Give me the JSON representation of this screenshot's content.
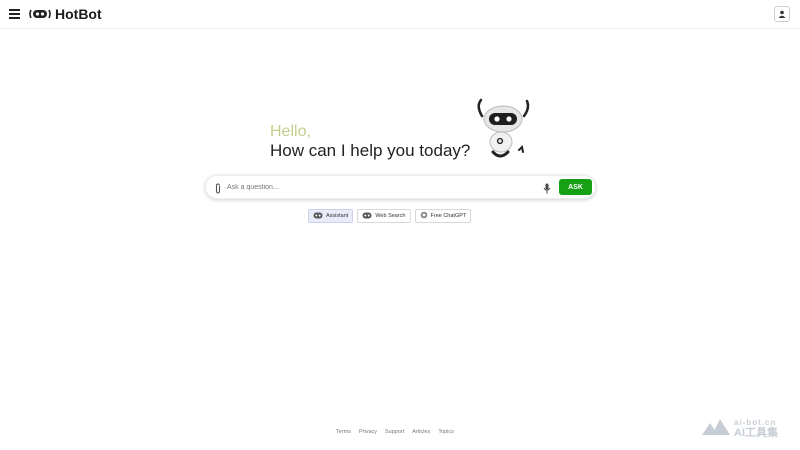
{
  "header": {
    "brand_name": "HotBot",
    "menu_icon": "hamburger-menu-icon",
    "logo_icon": "robot-logo-icon",
    "user_icon": "user-icon"
  },
  "hero": {
    "greeting": "Hello,",
    "headline": "How can I help you today?",
    "greeting_color": "#c2cf8a",
    "mascot_icon": "robot-mascot-icon"
  },
  "search": {
    "placeholder": "Ask a question...",
    "value": "",
    "attach_icon": "paperclip-icon",
    "mic_icon": "microphone-icon",
    "ask_label": "ASK",
    "ask_color": "#16a016"
  },
  "modes": [
    {
      "label": "Assistant",
      "icon": "assistant-icon",
      "active": true
    },
    {
      "label": "Web Search",
      "icon": "web-search-icon",
      "active": false
    },
    {
      "label": "Free ChatGPT",
      "icon": "chatgpt-icon",
      "active": false
    }
  ],
  "footer": {
    "links": [
      "Terms",
      "Privacy",
      "Support",
      "Articles",
      "Topics"
    ]
  },
  "watermark": {
    "domain": "ai-bot.cn",
    "label": "AI工具集"
  }
}
